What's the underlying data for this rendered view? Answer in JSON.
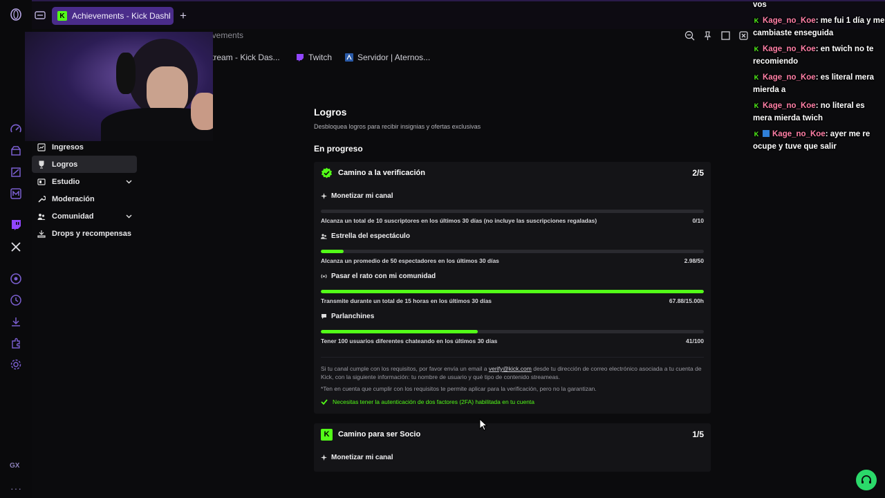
{
  "browser": {
    "tab_title": "Achievements - Kick Dashb",
    "tab_favicon": "K",
    "address_fragment": "evements",
    "bookmarks": [
      {
        "label": "tream - Kick Das...",
        "icon": "kick-icon"
      },
      {
        "label": "Twitch",
        "icon": "twitch-icon"
      },
      {
        "label": "Servidor | Aternos...",
        "icon": "aternos-icon"
      }
    ],
    "rail_bottom_label": "GX"
  },
  "sidebar": {
    "items": [
      {
        "label": "Ingresos",
        "icon": "revenue-icon"
      },
      {
        "label": "Logros",
        "icon": "trophy-icon",
        "active": true
      },
      {
        "label": "Estudio",
        "icon": "studio-icon",
        "expandable": true
      },
      {
        "label": "Moderación",
        "icon": "wrench-icon"
      },
      {
        "label": "Comunidad",
        "icon": "community-icon",
        "expandable": true
      },
      {
        "label": "Drops y recompensas",
        "icon": "drops-icon"
      }
    ]
  },
  "main": {
    "title": "Logros",
    "subtitle": "Desbloquea logros para recibir insignias y ofertas exclusivas",
    "section": "En progreso",
    "card1": {
      "title": "Camino a la verificación",
      "count": "2/5",
      "achievements": [
        {
          "title": "Monetizar mi canal",
          "desc": "Alcanza un total de 10 suscriptores en los últimos 30 días (no incluye las suscripciones regaladas)",
          "value": "0/10",
          "progress": 0
        },
        {
          "title": "Estrella del espectáculo",
          "desc": "Alcanza un promedio de 50 espectadores en los últimos 30 días",
          "value": "2.98/50",
          "progress": 0.06
        },
        {
          "title": "Pasar el rato con mi comunidad",
          "desc": "Transmite durante un total de 15 horas en los últimos 30 días",
          "value": "67.88/15.00h",
          "progress": 1
        },
        {
          "title": "Parlanchines",
          "desc": "Tener 100 usuarios diferentes chateando en los últimos 30 días",
          "value": "41/100",
          "progress": 0.41
        }
      ],
      "note_pre": "Si tu canal cumple con los requisitos, por favor envía un email a ",
      "note_email": "verify@kick.com",
      "note_post": " desde tu dirección de correo electrónico asociada a tu cuenta de Kick, con la siguiente información: tu nombre de usuario y qué tipo de contenido streameas.",
      "note2": "*Ten en cuenta que cumplir con los requisitos te permite aplicar para la verificación, pero no la garantizan.",
      "note3": "Necesitas tener la autenticación de dos factores (2FA) habilitada en tu cuenta"
    },
    "card2": {
      "title": "Camino para ser Socio",
      "count": "1/5",
      "first_achievement": "Monetizar mi canal"
    }
  },
  "chat": {
    "messages": [
      {
        "user": "",
        "text": "vos"
      },
      {
        "user": "Kage_no_Koe",
        "text": ": me fui 1 día y me cambiaste enseguida"
      },
      {
        "user": "Kage_no_Koe",
        "text": ": en twich no te recomiendo"
      },
      {
        "user": "Kage_no_Koe",
        "text": ": es literal mera mierda a"
      },
      {
        "user": "Kage_no_Koe",
        "text": ": no literal es mera mierda twich"
      },
      {
        "user": "Kage_no_Koe",
        "text": ": ayer me re ocupe y tuve que salir",
        "extra_badge": true
      }
    ]
  },
  "colors": {
    "accent_green": "#53fc18",
    "tab_purple": "#4a2c8a",
    "chat_username": "#ff7fa6"
  }
}
